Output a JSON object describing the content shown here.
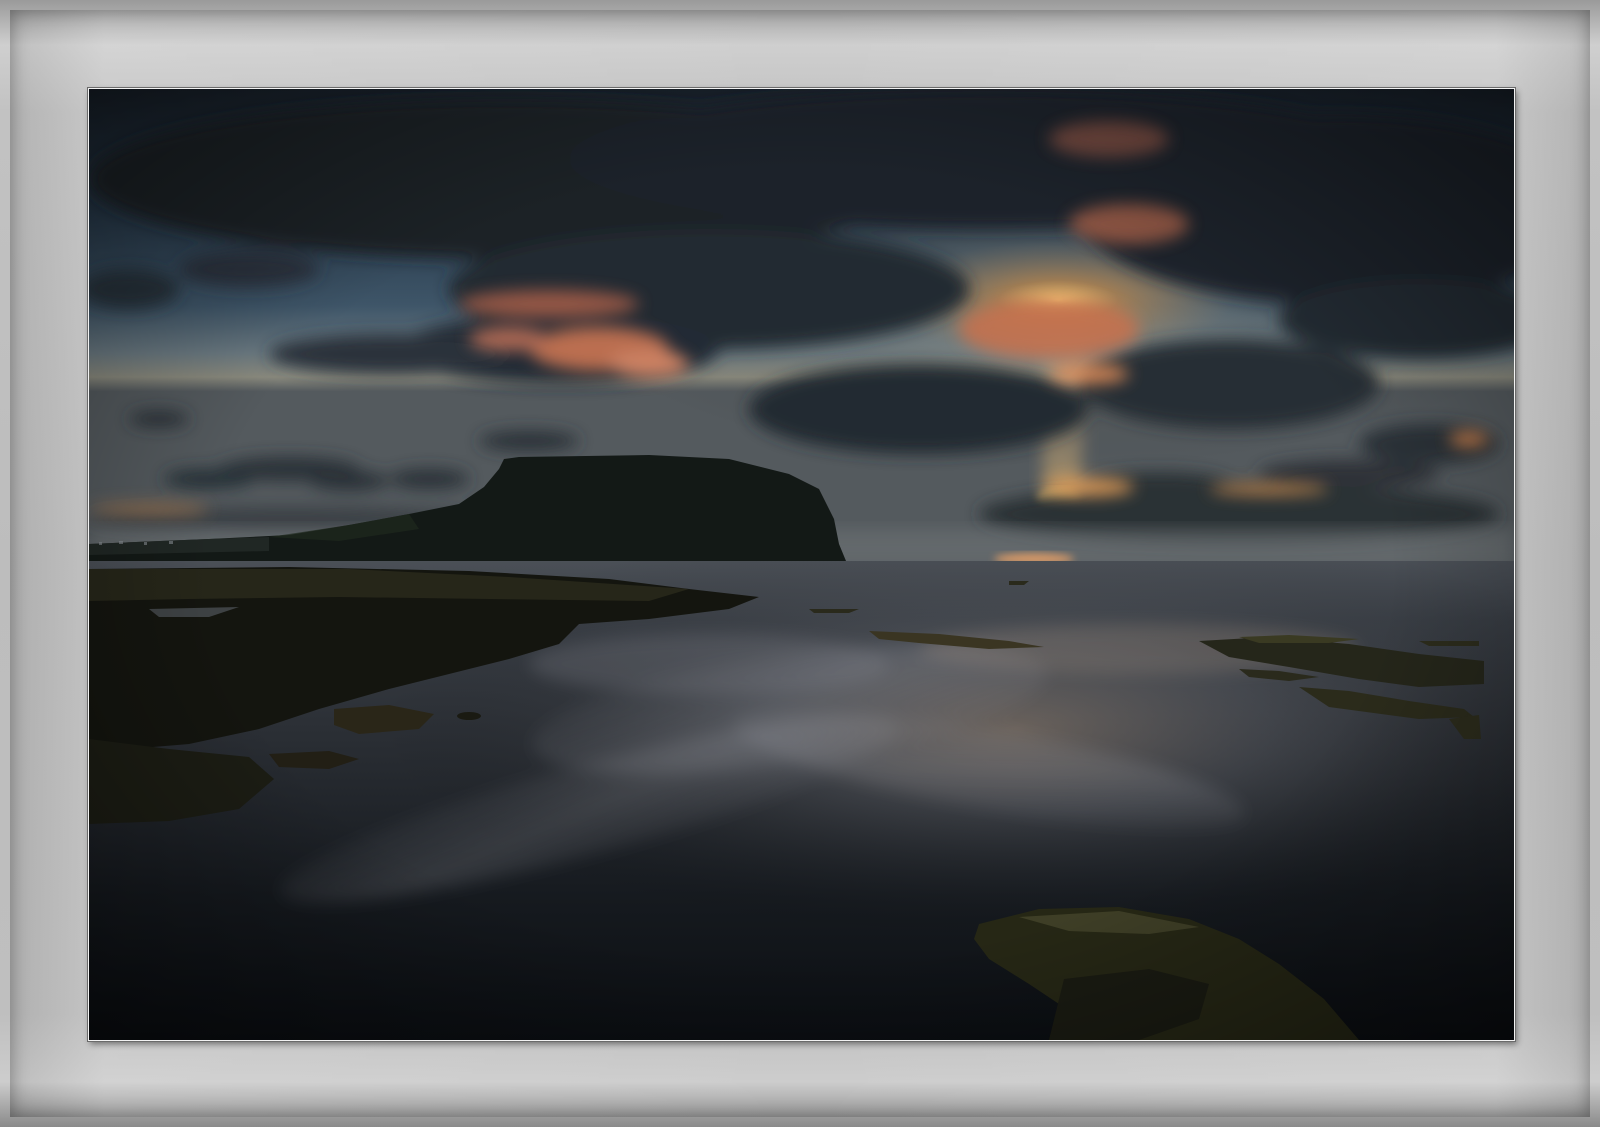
{
  "image": {
    "subject": "seascape-sunset",
    "palette": {
      "sky_top": "#1b2530",
      "sky_mid": "#3c5062",
      "horizon_glow": "#f3b451",
      "cloud_dark": "#1e252d",
      "cloud_lit": "#e7865a",
      "headland": "#141a17",
      "water_dark": "#0e1318",
      "water_light": "#7a8087",
      "rock_moss": "#3a3b22"
    }
  }
}
